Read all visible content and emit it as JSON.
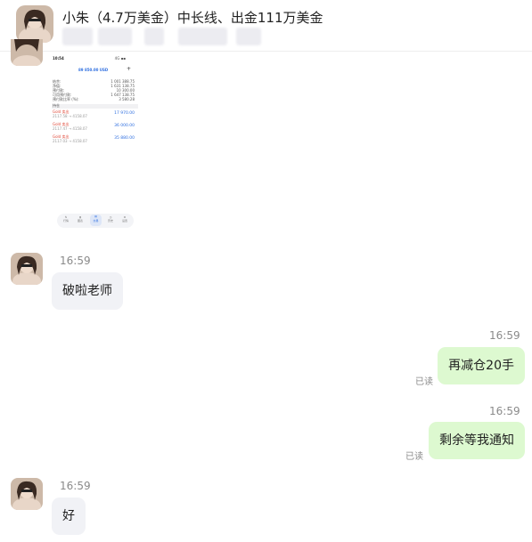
{
  "header": {
    "title": "小朱（4.7万美金）中长线、出金111万美金"
  },
  "embedded_screenshot": {
    "status_time": "10:54",
    "status_right": "4G ▪▪",
    "balance_title": "89 850.00 USD",
    "plus": "+",
    "rows": [
      {
        "label": "结余:",
        "value": "1 001 388.75"
      },
      {
        "label": "净值:",
        "value": "1 631 138.75"
      },
      {
        "label": "预付款:",
        "value": "10 300.00"
      },
      {
        "label": "可用预付款:",
        "value": "1 647 138.75"
      },
      {
        "label": "预付款比率 (%):",
        "value": "3 580.28"
      }
    ],
    "section": "持仓",
    "positions": [
      {
        "name": "Gold 卖出",
        "sub": "2117.58 → 4158.07",
        "value": "17 970.00"
      },
      {
        "name": "Gold 卖出",
        "sub": "2117.47 → 4158.07",
        "value": "36 000.00"
      },
      {
        "name": "Gold 卖出",
        "sub": "2117.03 → 4158.07",
        "value": "35 880.00"
      }
    ],
    "tabs": [
      "行情",
      "图表",
      "交易",
      "历史",
      "设置"
    ]
  },
  "messages": [
    {
      "side": "left",
      "time": "16:59",
      "text": "破啦老师"
    },
    {
      "side": "right",
      "time": "16:59",
      "text": "再减仓20手",
      "read": "已读"
    },
    {
      "side": "right",
      "time": "16:59",
      "text": "剩余等我通知",
      "read": "已读"
    },
    {
      "side": "left",
      "time": "16:59",
      "text": "好"
    }
  ],
  "colors": {
    "left_bubble": "#f1f2f6",
    "right_bubble": "#ddf9d0",
    "accent_blue": "#2f6fe0",
    "sell_red": "#e04a3a"
  }
}
